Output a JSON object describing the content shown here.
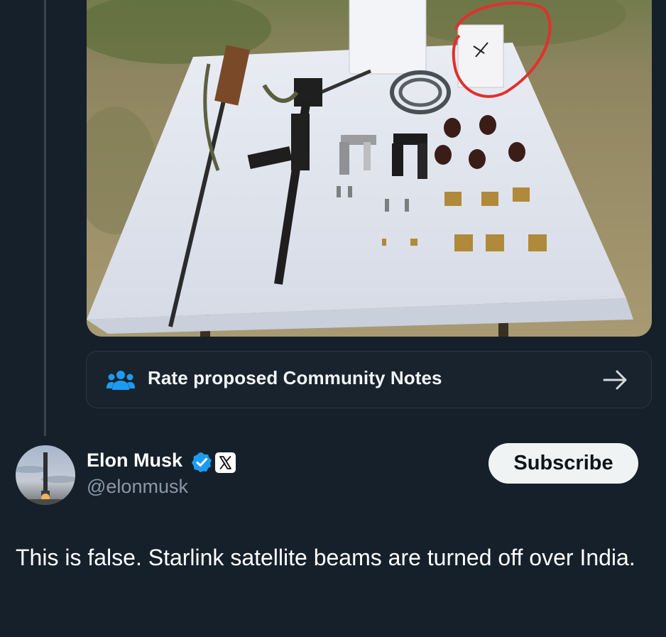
{
  "community_notes": {
    "label": "Rate proposed Community Notes",
    "icon": "people-group-icon",
    "arrow_icon": "arrow-right-icon"
  },
  "media": {
    "icon_name": "attached-photo"
  },
  "author": {
    "display_name": "Elon Musk",
    "handle": "@elonmusk",
    "verified": true,
    "affiliation_badge": "X"
  },
  "actions": {
    "subscribe_label": "Subscribe"
  },
  "post": {
    "text": "This is false. Starlink satellite beams are turned off over India."
  },
  "colors": {
    "background": "#15202b",
    "accent_blue": "#1d9bf0",
    "secondary_text": "#8b98a5",
    "subscribe_bg": "#eff3f4",
    "annotation_circle": "#e03030"
  }
}
